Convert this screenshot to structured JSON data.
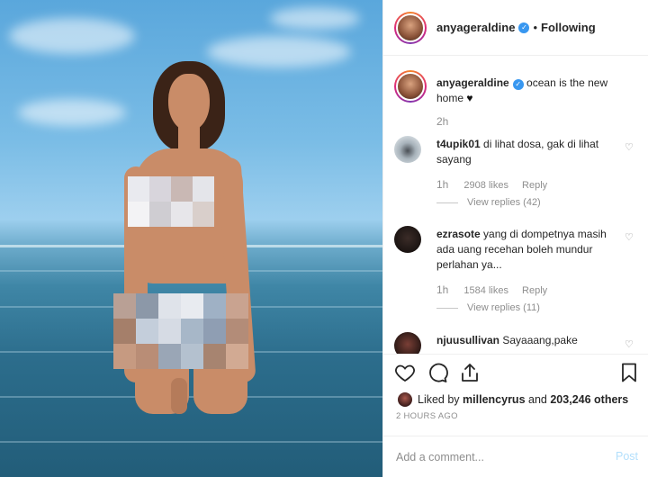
{
  "post": {
    "author": "anyageraldine",
    "follow_separator": "•",
    "follow_status": "Following",
    "caption": "ocean is the new home",
    "caption_emoji": "♥",
    "caption_time": "2h"
  },
  "comments": [
    {
      "username": "t4upik01",
      "text": "di lihat dosa, gak di lihat sayang",
      "time": "1h",
      "likes": "2908 likes",
      "reply_label": "Reply",
      "view_replies": "View replies (42)"
    },
    {
      "username": "ezrasote",
      "text": "yang di dompetnya masih ada uang recehan boleh mundur perlahan ya...",
      "time": "1h",
      "likes": "1584 likes",
      "reply_label": "Reply",
      "view_replies": "View replies (11)"
    },
    {
      "username": "njuusullivan",
      "text": "Sayaaang,pake"
    }
  ],
  "likes": {
    "prefix": "Liked by",
    "user": "millencyrus",
    "conjunction": "and",
    "others": "203,246 others"
  },
  "timestamp": "2 HOURS AGO",
  "add_comment": {
    "placeholder": "Add a comment...",
    "post_label": "Post"
  },
  "icons": [
    "verified-badge-icon",
    "heart-icon",
    "comment-icon",
    "share-icon",
    "bookmark-icon"
  ],
  "colors": {
    "verified": "#3897f0",
    "post_button_disabled": "#b2dffc",
    "meta_gray": "#8e8e8e"
  }
}
